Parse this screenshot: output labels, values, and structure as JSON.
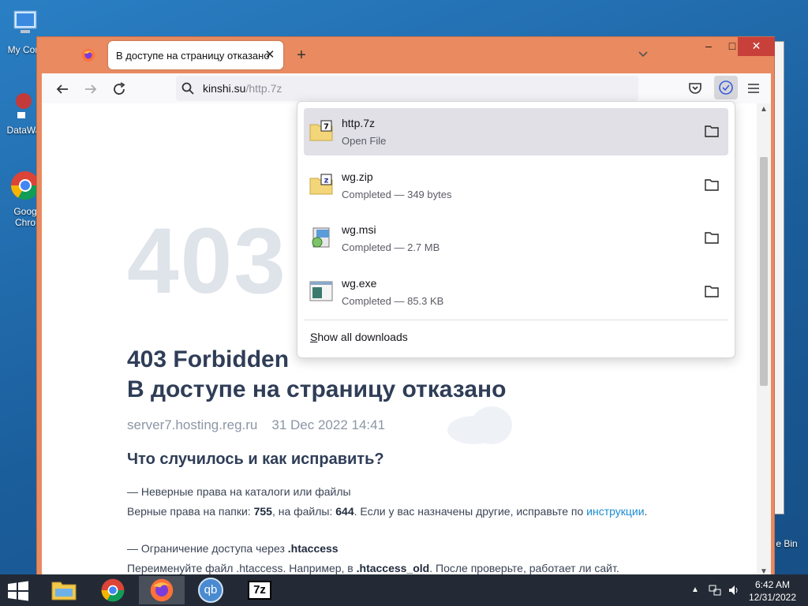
{
  "desktop": {
    "icons": [
      {
        "label": "My Com"
      },
      {
        "label": "DataWa"
      },
      {
        "label": "Goog Chro"
      },
      {
        "label": "e Bin"
      }
    ]
  },
  "browser": {
    "tab_title": "В доступе на страницу отказано",
    "tab_close": "✕",
    "new_tab": "+",
    "url_host": "kinshi.su",
    "url_path": "/http.7z",
    "window_controls": {
      "minimize": "–",
      "maximize": "□",
      "close": "✕"
    }
  },
  "page": {
    "big_code": "403",
    "heading_line1": "403 Forbidden",
    "heading_line2": "В доступе на страницу отказано",
    "server": "server7.hosting.reg.ru",
    "date": "31 Dec 2022 14:41",
    "section_title": "Что случилось и как исправить?",
    "item1_title": "— Неверные права на каталоги или файлы",
    "item1_text_a": "Верные права на папки: ",
    "item1_dirs": "755",
    "item1_text_b": ", на файлы: ",
    "item1_files": "644",
    "item1_text_c": ". Если у вас назначены другие, исправьте по ",
    "item1_link": "инструкции",
    "item1_text_d": ".",
    "item2_title_a": "— Ограничение доступа через ",
    "item2_title_b": ".htaccess",
    "item2_text_a": "Переименуйте файл .htaccess. Например, в ",
    "item2_old": ".htaccess_old",
    "item2_text_b": ". После проверьте, работает ли сайт."
  },
  "downloads": {
    "items": [
      {
        "name": "http.7z",
        "status": "Open File",
        "icon": "7z-archive-icon"
      },
      {
        "name": "wg.zip",
        "status": "Completed — 349 bytes",
        "icon": "zip-archive-icon"
      },
      {
        "name": "wg.msi",
        "status": "Completed — 2.7 MB",
        "icon": "msi-installer-icon"
      },
      {
        "name": "wg.exe",
        "status": "Completed — 85.3 KB",
        "icon": "exe-file-icon"
      }
    ],
    "show_all_first": "S",
    "show_all_rest": "how all downloads"
  },
  "taskbar": {
    "time": "6:42 AM",
    "date": "12/31/2022",
    "apps": [
      "file-explorer",
      "chrome",
      "firefox",
      "qbittorrent",
      "7zip"
    ],
    "qb_label": "qb",
    "sevenzip_label": "7z"
  }
}
